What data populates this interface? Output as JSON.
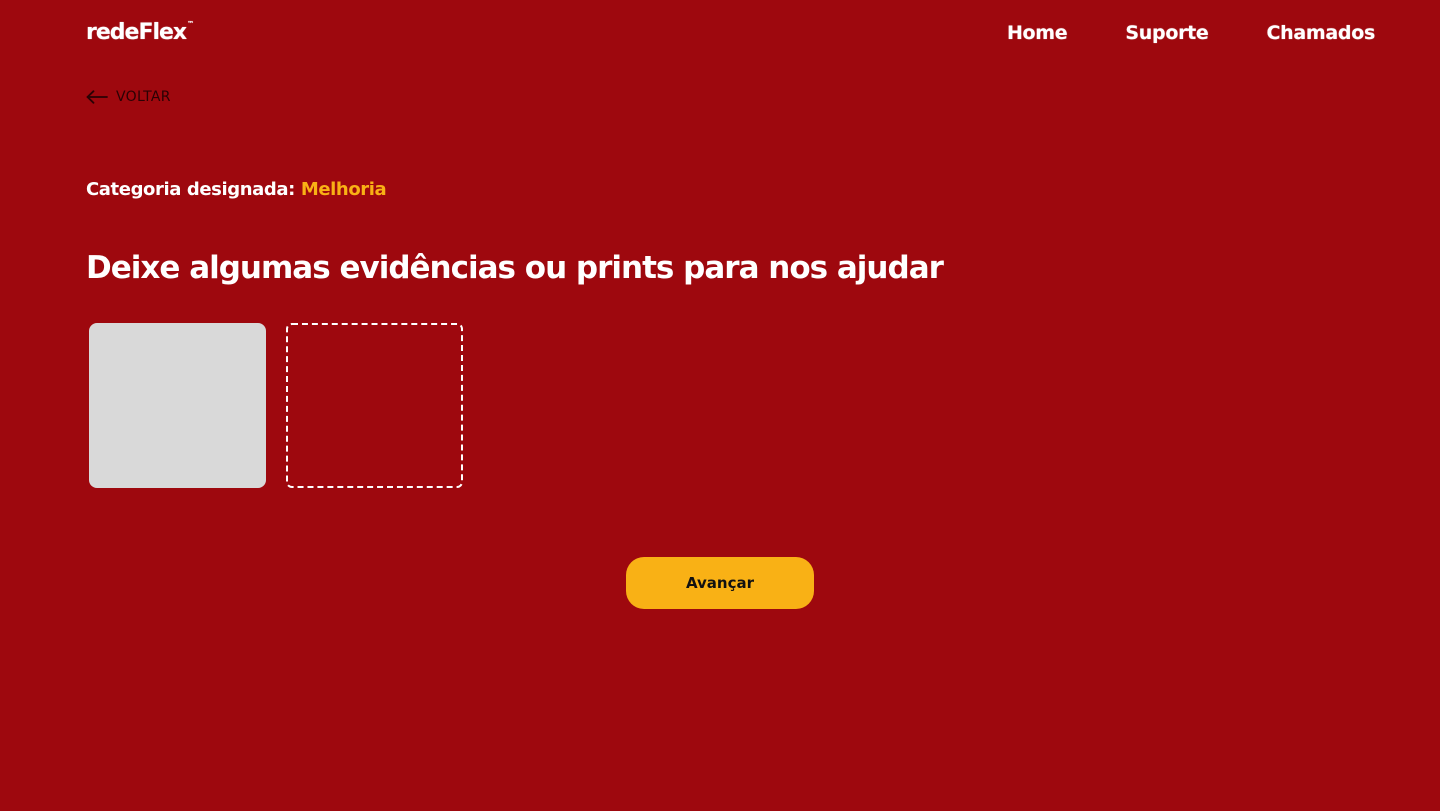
{
  "header": {
    "logo_text": "redeFlex",
    "logo_mark": "™",
    "nav": [
      {
        "label": "Home"
      },
      {
        "label": "Suporte"
      },
      {
        "label": "Chamados"
      }
    ]
  },
  "back": {
    "icon": "arrow-left-icon",
    "label": "VOLTAR"
  },
  "category": {
    "prefix": "Categoria designada:",
    "value": "Melhoria"
  },
  "heading": "Deixe algumas evidências ou prints para nos ajudar",
  "uploads": [
    {
      "state": "filled"
    },
    {
      "state": "empty"
    }
  ],
  "actions": {
    "advance_label": "Avançar"
  },
  "colors": {
    "background": "#9e080e",
    "accent": "#f9b115",
    "text": "#ffffff",
    "placeholder_tile": "#d9d9d9"
  }
}
